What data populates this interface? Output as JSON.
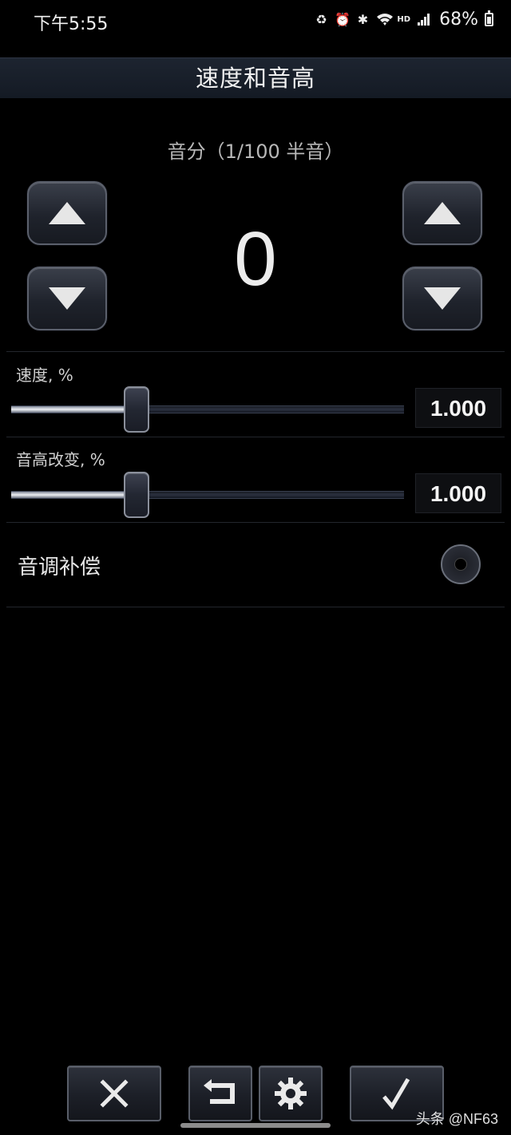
{
  "status_bar": {
    "time": "下午5:55",
    "icons": [
      "recycle-icon",
      "alarm-icon",
      "bluetooth-icon",
      "wifi-icon",
      "hd-icon",
      "signal-icon",
      "battery-icon"
    ],
    "hd_label": "HD",
    "battery_percent": "68%"
  },
  "header": {
    "title": "速度和音高"
  },
  "semitones": {
    "label": "音分（1/100 半音）",
    "value": "0"
  },
  "sliders": [
    {
      "label": "速度, %",
      "value": "1.000",
      "position": 0.29
    },
    {
      "label": "音高改变, %",
      "value": "1.000",
      "position": 0.29
    }
  ],
  "toggle": {
    "label": "音调补偿",
    "checked": false
  },
  "toolbar": {
    "buttons": [
      "close-icon",
      "undo-icon",
      "gear-icon",
      "check-icon"
    ]
  },
  "watermark": "头条 @NF63",
  "colors": {
    "background": "#000000",
    "title_bar": "#182030",
    "accent_text": "#e8e8e8"
  }
}
